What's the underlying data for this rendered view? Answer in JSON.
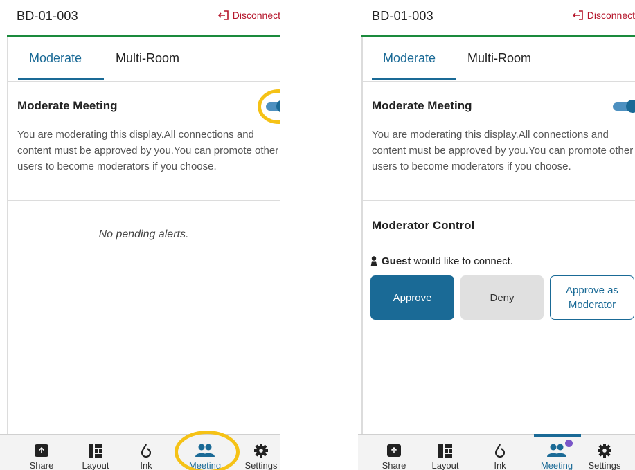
{
  "left": {
    "device_name": "BD-01-003",
    "disconnect_label": "Disconnect",
    "tabs": [
      {
        "label": "Moderate",
        "active": true
      },
      {
        "label": "Multi-Room",
        "active": false
      }
    ],
    "moderate_title": "Moderate Meeting",
    "moderate_toggle_on": true,
    "moderate_desc": "You are moderating this display.All connections and content must be approved by you.You can promote other users to become moderators if you choose.",
    "empty_message": "No pending alerts.",
    "nav": [
      {
        "label": "Share",
        "icon": "share-icon"
      },
      {
        "label": "Layout",
        "icon": "layout-icon"
      },
      {
        "label": "Ink",
        "icon": "ink-drop-icon"
      },
      {
        "label": "Meeting",
        "icon": "people-icon",
        "active": true
      },
      {
        "label": "Settings",
        "icon": "gear-icon"
      }
    ]
  },
  "right": {
    "device_name": "BD-01-003",
    "disconnect_label": "Disconnect",
    "tabs": [
      {
        "label": "Moderate",
        "active": true
      },
      {
        "label": "Multi-Room",
        "active": false
      }
    ],
    "moderate_title": "Moderate Meeting",
    "moderate_toggle_on": true,
    "moderate_desc": "You are moderating this display.All connections and content must be approved by you.You can promote other users to become moderators if you choose.",
    "control_title": "Moderator Control",
    "guest_name": "Guest",
    "guest_message": "would like to connect.",
    "approve_label": "Approve",
    "deny_label": "Deny",
    "approve_mod_label": "Approve as Moderator",
    "nav": [
      {
        "label": "Share",
        "icon": "share-icon"
      },
      {
        "label": "Layout",
        "icon": "layout-icon"
      },
      {
        "label": "Ink",
        "icon": "ink-drop-icon"
      },
      {
        "label": "Meeting",
        "icon": "people-icon",
        "active": true
      },
      {
        "label": "Settings",
        "icon": "gear-icon"
      }
    ]
  },
  "colors": {
    "accent": "#1a6a96",
    "disconnect": "#b5162b",
    "header_line": "#1a8a3c",
    "highlight": "#f5c216",
    "badge": "#7a56c8"
  }
}
